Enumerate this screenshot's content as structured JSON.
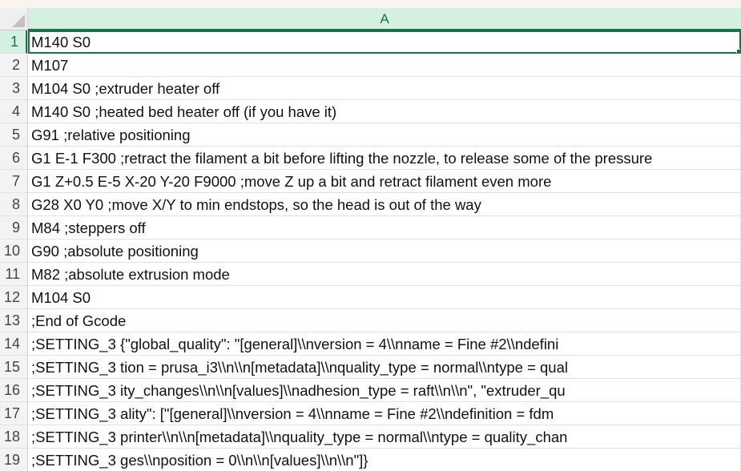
{
  "column_header": "A",
  "colors": {
    "selection": "#1e7145",
    "header_active_bg": "#d3f0e0"
  },
  "active_cell": "A1",
  "rows": [
    {
      "num": "1",
      "text": "M140 S0"
    },
    {
      "num": "2",
      "text": "M107"
    },
    {
      "num": "3",
      "text": "M104 S0 ;extruder heater off"
    },
    {
      "num": "4",
      "text": "M140 S0 ;heated bed heater off (if you have it)"
    },
    {
      "num": "5",
      "text": "G91 ;relative positioning"
    },
    {
      "num": "6",
      "text": "G1 E-1 F300  ;retract the filament a bit before lifting the nozzle, to release some of the pressure"
    },
    {
      "num": "7",
      "text": "G1 Z+0.5 E-5 X-20 Y-20 F9000 ;move Z up a bit and retract filament even more"
    },
    {
      "num": "8",
      "text": "G28 X0 Y0 ;move X/Y to min endstops, so the head is out of the way"
    },
    {
      "num": "9",
      "text": "M84 ;steppers off"
    },
    {
      "num": "10",
      "text": "G90 ;absolute positioning"
    },
    {
      "num": "11",
      "text": "M82 ;absolute extrusion mode"
    },
    {
      "num": "12",
      "text": "M104 S0"
    },
    {
      "num": "13",
      "text": ";End of Gcode"
    },
    {
      "num": "14",
      "text": ";SETTING_3 {\"global_quality\": \"[general]\\\\nversion = 4\\\\nname = Fine #2\\\\ndefini"
    },
    {
      "num": "15",
      "text": ";SETTING_3 tion = prusa_i3\\\\n\\\\n[metadata]\\\\nquality_type = normal\\\\ntype = qual"
    },
    {
      "num": "16",
      "text": ";SETTING_3 ity_changes\\\\n\\\\n[values]\\\\nadhesion_type = raft\\\\n\\\\n\", \"extruder_qu"
    },
    {
      "num": "17",
      "text": ";SETTING_3 ality\": [\"[general]\\\\nversion = 4\\\\nname = Fine #2\\\\ndefinition = fdm"
    },
    {
      "num": "18",
      "text": ";SETTING_3 printer\\\\n\\\\n[metadata]\\\\nquality_type = normal\\\\ntype = quality_chan"
    },
    {
      "num": "19",
      "text": ";SETTING_3 ges\\\\nposition = 0\\\\n\\\\n[values]\\\\n\\\\n\"]}"
    }
  ]
}
